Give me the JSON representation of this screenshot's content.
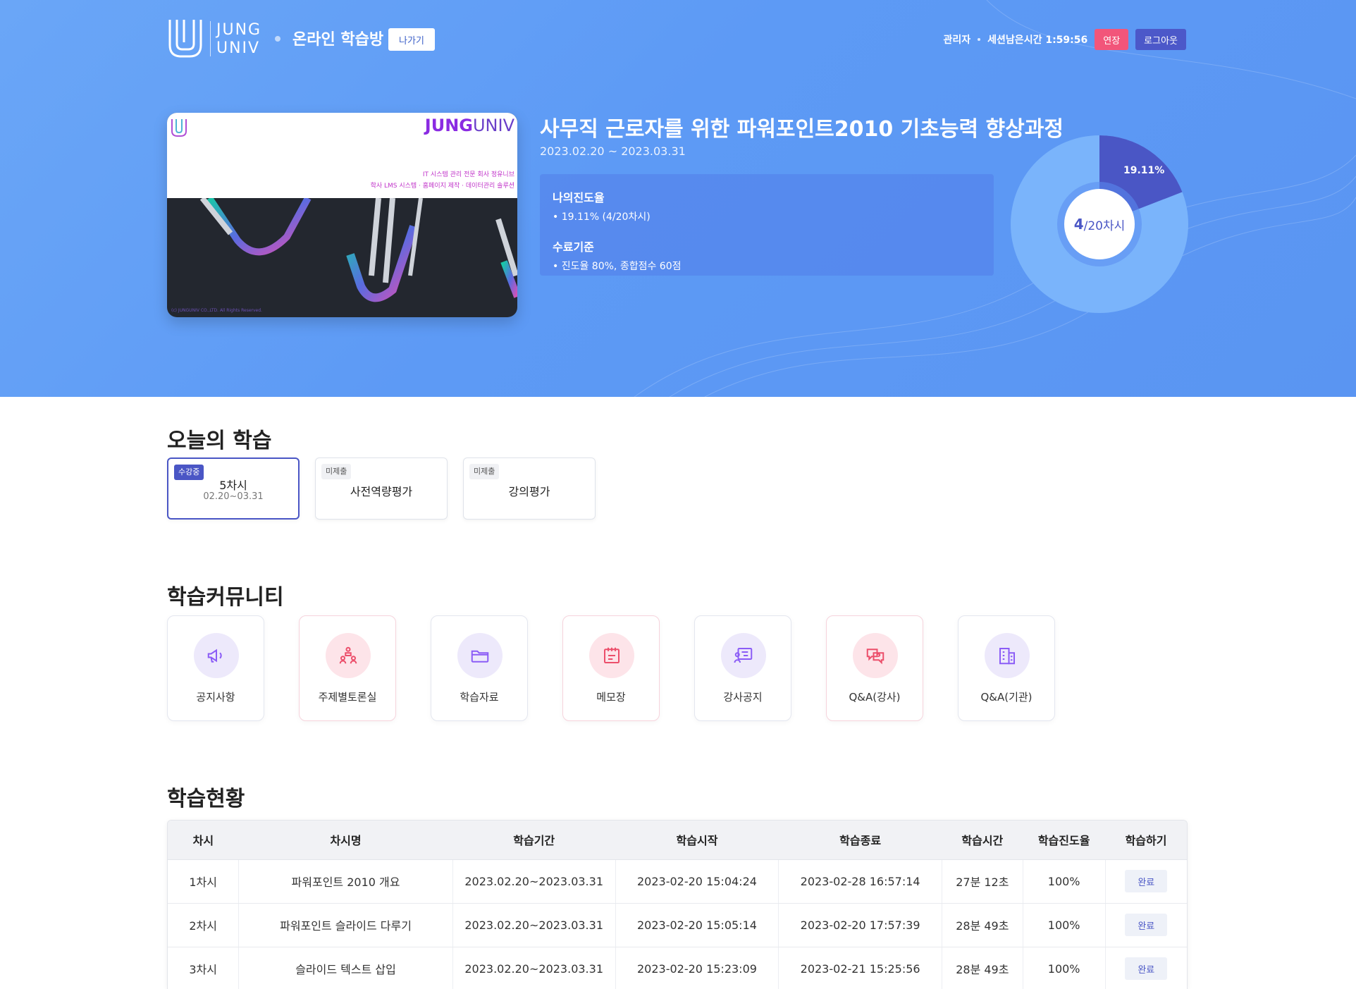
{
  "header": {
    "logo_line1": "JUNG",
    "logo_line2": "UNIV",
    "room_title": "온라인 학습방",
    "exit_label": "나가기",
    "user_role": "관리자",
    "session_text": "세션남은시간 1:59:56",
    "extend_label": "연장",
    "logout_label": "로그아웃"
  },
  "thumbnail": {
    "brand_bold": "JUNG",
    "brand_light": "UNIV",
    "line1": "IT 시스템 관리 전문 회사 정유니브",
    "line2": "학사 LMS 시스템 · 홈페이지 제작 · 데이터관리 솔루션",
    "copyright": "(c) JUNGUNIV CO.,LTD. All Rights Reserved."
  },
  "course": {
    "title": "사무직 근로자를 위한 파워포인트2010 기초능력 향상과정",
    "period": "2023.02.20 ~ 2023.03.31",
    "progress_heading": "나의진도율",
    "progress_value": "• 19.11% (4/20차시)",
    "criteria_heading": "수료기준",
    "criteria_value": "• 진도율 80%, 종합점수 60점",
    "progress_fraction": 0.1911,
    "progress_pct_label": "19.11%",
    "center_done": "4",
    "center_total": "/20차시"
  },
  "today": {
    "title": "오늘의 학습",
    "cards": [
      {
        "badge": "수강중",
        "label": "5차시",
        "sub": "02.20~03.31"
      },
      {
        "badge": "미제출",
        "label": "사전역량평가"
      },
      {
        "badge": "미제출",
        "label": "강의평가"
      }
    ]
  },
  "community": {
    "title": "학습커뮤니티",
    "items": [
      {
        "label": "공지사항",
        "icon": "megaphone-icon"
      },
      {
        "label": "주제별토론실",
        "icon": "discussion-icon"
      },
      {
        "label": "학습자료",
        "icon": "folder-icon"
      },
      {
        "label": "메모장",
        "icon": "notepad-icon"
      },
      {
        "label": "강사공지",
        "icon": "instructor-board-icon"
      },
      {
        "label": "Q&A(강사)",
        "icon": "question-chat-icon"
      },
      {
        "label": "Q&A(기관)",
        "icon": "building-icon"
      }
    ]
  },
  "status": {
    "title": "학습현황",
    "columns": [
      "차시",
      "차시명",
      "학습기간",
      "학습시작",
      "학습종료",
      "학습시간",
      "학습진도율",
      "학습하기"
    ],
    "rows": [
      [
        "1차시",
        "파워포인트 2010 개요",
        "2023.02.20~2023.03.31",
        "2023-02-20 15:04:24",
        "2023-02-28 16:57:14",
        "27분 12초",
        "100%",
        "완료"
      ],
      [
        "2차시",
        "파워포인트 슬라이드 다루기",
        "2023.02.20~2023.03.31",
        "2023-02-20 15:05:14",
        "2023-02-20 17:57:39",
        "28분 49초",
        "100%",
        "완료"
      ],
      [
        "3차시",
        "슬라이드 텍스트 삽입",
        "2023.02.20~2023.03.31",
        "2023-02-20 15:23:09",
        "2023-02-21 15:25:56",
        "28분 49초",
        "100%",
        "완료"
      ]
    ]
  },
  "colors": {
    "accent": "#4a56c5",
    "hero_blue": "#5d9af5",
    "extend_pink": "#f2557a"
  }
}
